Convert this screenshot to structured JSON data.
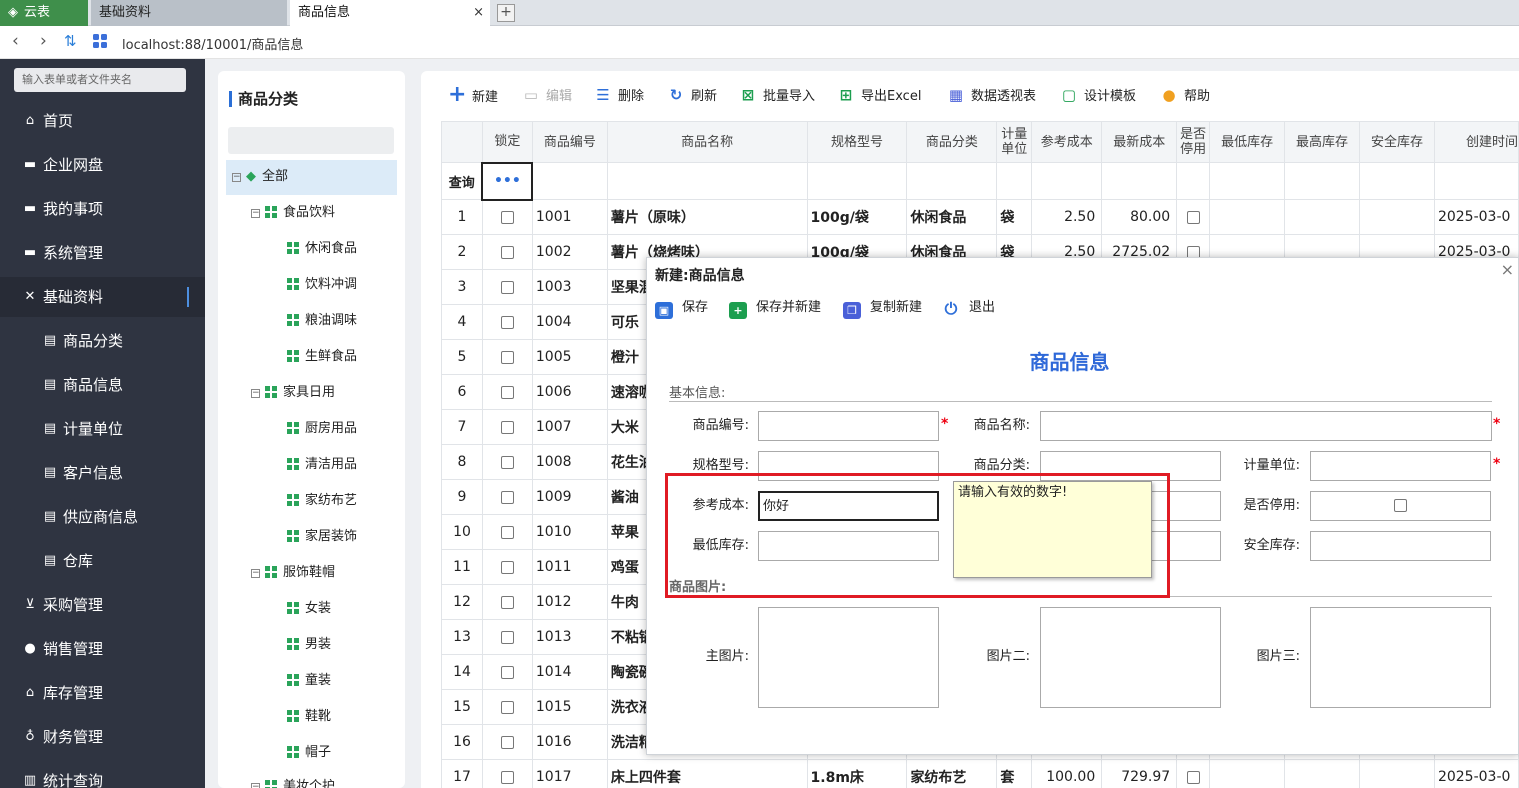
{
  "tabs": {
    "app": "云表",
    "basic": "基础资料",
    "goods": "商品信息",
    "close": "×",
    "new": "+"
  },
  "address": {
    "url": "localhost:88/10001/商品信息"
  },
  "sidebar": {
    "search_placeholder": "输入表单或者文件夹名",
    "items": [
      {
        "label": "首页",
        "icon": "home-icon"
      },
      {
        "label": "企业网盘",
        "icon": "folder-icon"
      },
      {
        "label": "我的事项",
        "icon": "folder-icon"
      },
      {
        "label": "系统管理",
        "icon": "folder-icon"
      },
      {
        "label": "基础资料",
        "icon": "tools-icon"
      },
      {
        "label": "商品分类",
        "icon": "doc-icon"
      },
      {
        "label": "商品信息",
        "icon": "doc-icon"
      },
      {
        "label": "计量单位",
        "icon": "doc-icon"
      },
      {
        "label": "客户信息",
        "icon": "doc-icon"
      },
      {
        "label": "供应商信息",
        "icon": "doc-icon"
      },
      {
        "label": "仓库",
        "icon": "doc-icon"
      },
      {
        "label": "采购管理",
        "icon": "cart-icon"
      },
      {
        "label": "销售管理",
        "icon": "user-icon"
      },
      {
        "label": "库存管理",
        "icon": "home-icon"
      },
      {
        "label": "财务管理",
        "icon": "money-icon"
      },
      {
        "label": "统计查询",
        "icon": "chart-icon"
      }
    ]
  },
  "tree": {
    "title": "商品分类",
    "root": "全部",
    "nodes": [
      {
        "label": "食品饮料",
        "level": 1
      },
      {
        "label": "休闲食品",
        "level": 2
      },
      {
        "label": "饮料冲调",
        "level": 2
      },
      {
        "label": "粮油调味",
        "level": 2
      },
      {
        "label": "生鲜食品",
        "level": 2
      },
      {
        "label": "家具日用",
        "level": 1
      },
      {
        "label": "厨房用品",
        "level": 2
      },
      {
        "label": "清洁用品",
        "level": 2
      },
      {
        "label": "家纺布艺",
        "level": 2
      },
      {
        "label": "家居装饰",
        "level": 2
      },
      {
        "label": "服饰鞋帽",
        "level": 1
      },
      {
        "label": "女装",
        "level": 2
      },
      {
        "label": "男装",
        "level": 2
      },
      {
        "label": "童装",
        "level": 2
      },
      {
        "label": "鞋靴",
        "level": 2
      },
      {
        "label": "帽子",
        "level": 2
      },
      {
        "label": "美妆个护",
        "level": 1
      }
    ]
  },
  "toolbar": {
    "new": "新建",
    "edit": "编辑",
    "delete": "删除",
    "refresh": "刷新",
    "batch_import": "批量导入",
    "export_excel": "导出Excel",
    "pivot": "数据透视表",
    "design": "设计模板",
    "help": "帮助"
  },
  "grid": {
    "headers": [
      "锁定",
      "商品编号",
      "商品名称",
      "规格型号",
      "商品分类",
      "计量单位",
      "参考成本",
      "最新成本",
      "是否停用",
      "最低库存",
      "最高库存",
      "安全库存",
      "创建时间"
    ],
    "query_label": "查询",
    "query_more": "•••",
    "rows": [
      {
        "n": "1",
        "code": "1001",
        "name": "薯片（原味）",
        "spec": "100g/袋",
        "cat": "休闲食品",
        "unit": "袋",
        "ref": "2.50",
        "latest": "80.00",
        "date": "2025-03-0"
      },
      {
        "n": "2",
        "code": "1002",
        "name": "薯片（烧烤味）",
        "spec": "100g/袋",
        "cat": "休闲食品",
        "unit": "袋",
        "ref": "2.50",
        "latest": "2725.02",
        "date": "2025-03-0"
      },
      {
        "n": "3",
        "code": "1003",
        "name": "坚果混",
        "spec": "",
        "cat": "",
        "unit": "",
        "ref": "",
        "latest": "",
        "date": ""
      },
      {
        "n": "4",
        "code": "1004",
        "name": "可乐",
        "spec": "",
        "cat": "",
        "unit": "",
        "ref": "",
        "latest": "",
        "date": ""
      },
      {
        "n": "5",
        "code": "1005",
        "name": "橙汁",
        "spec": "",
        "cat": "",
        "unit": "",
        "ref": "",
        "latest": "",
        "date": ""
      },
      {
        "n": "6",
        "code": "1006",
        "name": "速溶咖",
        "spec": "",
        "cat": "",
        "unit": "",
        "ref": "",
        "latest": "",
        "date": ""
      },
      {
        "n": "7",
        "code": "1007",
        "name": "大米",
        "spec": "",
        "cat": "",
        "unit": "",
        "ref": "",
        "latest": "",
        "date": ""
      },
      {
        "n": "8",
        "code": "1008",
        "name": "花生油",
        "spec": "",
        "cat": "",
        "unit": "",
        "ref": "",
        "latest": "",
        "date": ""
      },
      {
        "n": "9",
        "code": "1009",
        "name": "酱油",
        "spec": "",
        "cat": "",
        "unit": "",
        "ref": "",
        "latest": "",
        "date": ""
      },
      {
        "n": "10",
        "code": "1010",
        "name": "苹果",
        "spec": "",
        "cat": "",
        "unit": "",
        "ref": "",
        "latest": "",
        "date": ""
      },
      {
        "n": "11",
        "code": "1011",
        "name": "鸡蛋",
        "spec": "",
        "cat": "",
        "unit": "",
        "ref": "",
        "latest": "",
        "date": ""
      },
      {
        "n": "12",
        "code": "1012",
        "name": "牛肉",
        "spec": "",
        "cat": "",
        "unit": "",
        "ref": "",
        "latest": "",
        "date": ""
      },
      {
        "n": "13",
        "code": "1013",
        "name": "不粘锅",
        "spec": "",
        "cat": "",
        "unit": "",
        "ref": "",
        "latest": "",
        "date": ""
      },
      {
        "n": "14",
        "code": "1014",
        "name": "陶瓷碗",
        "spec": "",
        "cat": "",
        "unit": "",
        "ref": "",
        "latest": "",
        "date": ""
      },
      {
        "n": "15",
        "code": "1015",
        "name": "洗衣液",
        "spec": "",
        "cat": "",
        "unit": "",
        "ref": "",
        "latest": "",
        "date": ""
      },
      {
        "n": "16",
        "code": "1016",
        "name": "洗洁精",
        "spec": "",
        "cat": "",
        "unit": "",
        "ref": "",
        "latest": "",
        "date": ""
      },
      {
        "n": "17",
        "code": "1017",
        "name": "床上四件套",
        "spec": "1.8m床",
        "cat": "家纺布艺",
        "unit": "套",
        "ref": "100.00",
        "latest": "729.97",
        "date": "2025-03-0"
      }
    ]
  },
  "modal": {
    "title": "新建:商品信息",
    "close": "×",
    "save": "保存",
    "save_new": "保存并新建",
    "copy_new": "复制新建",
    "exit": "退出",
    "form_title": "商品信息",
    "section_basic": "基本信息:",
    "section_image": "商品图片:",
    "labels": {
      "code": "商品编号:",
      "name": "商品名称:",
      "spec": "规格型号:",
      "category": "商品分类:",
      "unit": "计量单位:",
      "ref_cost": "参考成本:",
      "disabled": "是否停用:",
      "min_stock": "最低库存:",
      "safe_stock": "安全库存:",
      "main_pic": "主图片:",
      "pic2": "图片二:",
      "pic3": "图片三:"
    },
    "values": {
      "ref_cost": "你好"
    },
    "required_mark": "*",
    "tooltip": "请输入有效的数字!"
  },
  "colors": {
    "sidebar_bg": "#2f3441",
    "accent_blue": "#2e68d8",
    "highlight_red": "#e01b24",
    "tooltip_bg": "#ffffd8",
    "app_green": "#3f8f4b"
  }
}
